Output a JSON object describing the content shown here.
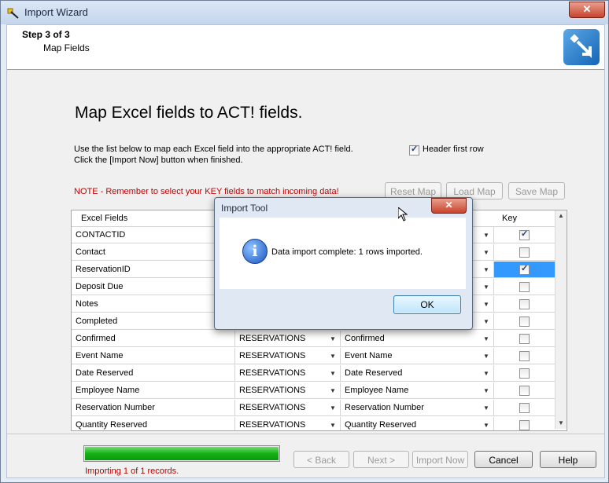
{
  "window": {
    "title": "Import Wizard"
  },
  "header": {
    "step": "Step 3 of 3",
    "subtitle": "Map Fields"
  },
  "main": {
    "heading": "Map Excel fields to ACT! fields.",
    "instructions": [
      "Use the list below to map each Excel field into the appropriate ACT! field.",
      "Click the [Import Now] button when finished."
    ],
    "header_first_row": {
      "label": "Header first row",
      "checked": true
    },
    "note": "NOTE - Remember to select your KEY fields to match incoming data!",
    "buttons": {
      "reset_map": "Reset Map",
      "load_map": "Load Map",
      "save_map": "Save Map"
    }
  },
  "grid": {
    "columns": [
      "Excel Fields",
      "",
      "",
      "Key"
    ],
    "rows": [
      {
        "excel": "CONTACTID",
        "table": "",
        "field": "",
        "key": true,
        "selected": false
      },
      {
        "excel": "Contact",
        "table": "",
        "field": "",
        "key": false,
        "selected": false
      },
      {
        "excel": "ReservationID",
        "table": "",
        "field": "",
        "key": true,
        "selected": true
      },
      {
        "excel": "Deposit Due",
        "table": "",
        "field": "",
        "key": false,
        "selected": false
      },
      {
        "excel": "Notes",
        "table": "",
        "field": "",
        "key": false,
        "selected": false
      },
      {
        "excel": "Completed",
        "table": "",
        "field": "",
        "key": false,
        "selected": false
      },
      {
        "excel": "Confirmed",
        "table": "RESERVATIONS",
        "field": "Confirmed",
        "key": false,
        "selected": false
      },
      {
        "excel": "Event Name",
        "table": "RESERVATIONS",
        "field": "Event Name",
        "key": false,
        "selected": false
      },
      {
        "excel": "Date Reserved",
        "table": "RESERVATIONS",
        "field": "Date Reserved",
        "key": false,
        "selected": false
      },
      {
        "excel": "Employee Name",
        "table": "RESERVATIONS",
        "field": "Employee Name",
        "key": false,
        "selected": false
      },
      {
        "excel": "Reservation Number",
        "table": "RESERVATIONS",
        "field": "Reservation Number",
        "key": false,
        "selected": false
      },
      {
        "excel": "Quantity Reserved",
        "table": "RESERVATIONS",
        "field": "Quantity Reserved",
        "key": false,
        "selected": false
      }
    ]
  },
  "footer": {
    "progress_fraction": 1.0,
    "progress_text": "Importing 1 of 1 records.",
    "back": "< Back",
    "next": "Next >",
    "import_now": "Import Now",
    "cancel": "Cancel",
    "help": "Help"
  },
  "dialog": {
    "title": "Import Tool",
    "close": "✕",
    "message": "Data import complete: 1 rows imported.",
    "ok": "OK",
    "icon": "info-icon"
  },
  "icons": {
    "app": "wizard-wand-icon",
    "wizard": "import-arrow-icon",
    "close": "close-icon"
  }
}
